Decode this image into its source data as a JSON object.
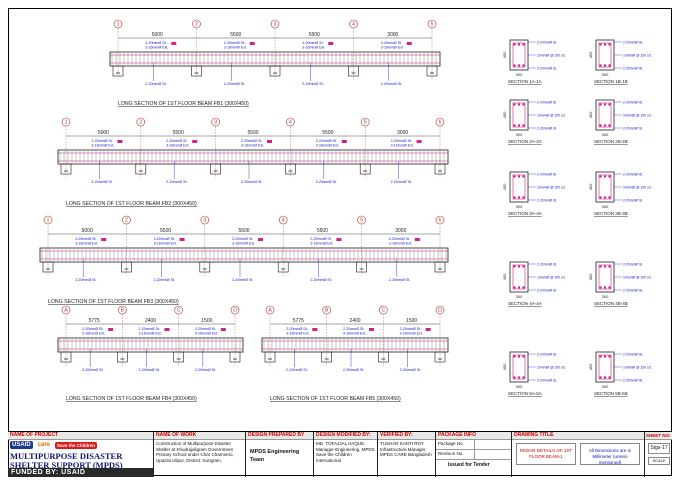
{
  "beams": [
    {
      "title": "LONG SECTION OF 1ST FLOOR BEAM FB1 (300X450)",
      "grid": [
        "1",
        "2",
        "3",
        "4",
        "5"
      ],
      "spans": [
        "5000",
        "5500",
        "5500",
        "3000"
      ]
    },
    {
      "title": "LONG SECTION OF 1ST FLOOR BEAM FB2 (300X450)",
      "grid": [
        "1",
        "2",
        "3",
        "4",
        "5",
        "6"
      ],
      "spans": [
        "5000",
        "5500",
        "5500",
        "5500",
        "3000"
      ]
    },
    {
      "title": "LONG SECTION OF 1ST FLOOR BEAM FB3 (300X450)",
      "grid": [
        "1",
        "2",
        "3",
        "4",
        "5",
        "6"
      ],
      "spans": [
        "5000",
        "5500",
        "5500",
        "5500",
        "3000"
      ]
    },
    {
      "title": "LONG SECTION OF 1ST FLOOR BEAM FB4 (300X450)",
      "grid": [
        "A",
        "B",
        "C",
        "D"
      ],
      "spans": [
        "5775",
        "2400",
        "1500"
      ]
    },
    {
      "title": "LONG SECTION OF 1ST FLOOR BEAM FB5 (300X450)",
      "grid": [
        "A",
        "B",
        "C",
        "D"
      ],
      "spans": [
        "5775",
        "2400",
        "1500"
      ]
    }
  ],
  "rebar_labels": {
    "top": "2-20mmØ St.",
    "extra": "3-16mmØ Ext.",
    "bottom": "2-20mmØ St.",
    "ring": "10mmØ @ 150 c/c"
  },
  "sections": [
    {
      "left": "SECTION 1A-1A",
      "right": "SECTION 1B-1B"
    },
    {
      "left": "SECTION 2A-2A",
      "right": "SECTION 2B-2B"
    },
    {
      "left": "SECTION 3A-3A",
      "right": "SECTION 3B-3B"
    },
    {
      "left": "SECTION 4A-4A",
      "right": "SECTION 4B-4B"
    },
    {
      "left": "SECTION 5A-5A",
      "right": "SECTION 5B-5B"
    }
  ],
  "section_dims": {
    "width": "300",
    "depth": "450"
  },
  "title_block": {
    "name_of_project_label": "NAME OF PROJECT",
    "logos": [
      "USAID",
      "care",
      "Save the Children"
    ],
    "project_name": "MULTIPURPOSE DISASTER SHELTER SUPPORT (MPDS) PROJECT",
    "funded_by": "FUNDED BY: USAID",
    "name_of_work_label": "NAME OF WORK",
    "name_of_work": "Construction of Multipurpose Disaster Shelter at Khudrajaligram Government Primary School under Char Charmerio, Upazila Ulipur, District: Kurigram.",
    "design_prepared_label": "DESIGN PREPARED BY",
    "design_prepared": "MPDS Engineering Team",
    "design_modified_label": "DESIGN MODIFIED BY:",
    "design_modified": "MD. TOFAJJAL HAQUE, Manager-Engineering, MPDS Save the Children International",
    "verified_label": "VERIFIED BY:",
    "verified": "TUSHAR KANTI ROY Infrastructure Manager, MPDS CARE Bangladesh",
    "package_label": "PACKAGE INFO",
    "package_rows": [
      {
        "k": "Package No.",
        "v": ""
      },
      {
        "k": "Revision No.",
        "v": ""
      }
    ],
    "issued": "Issued for Tender",
    "drawing_title_label": "DRAWING TITLE",
    "drawing_title": "REBAR DETAILS OF 1ST FLOOR BEAM-1",
    "drawing_note": "All Dimensions are in Millimeter (unless mentioned)",
    "sheet_no_label": "SHEET NO:",
    "sheet_no": "Stgs-17",
    "scale_label": "SCALE"
  },
  "colors": {
    "line": "#1c1c1c",
    "rebar": "#d0208a",
    "dim": "#1010c8",
    "grid": "#b03030",
    "hdr_text": "#cc0000",
    "title": "#14146e"
  }
}
